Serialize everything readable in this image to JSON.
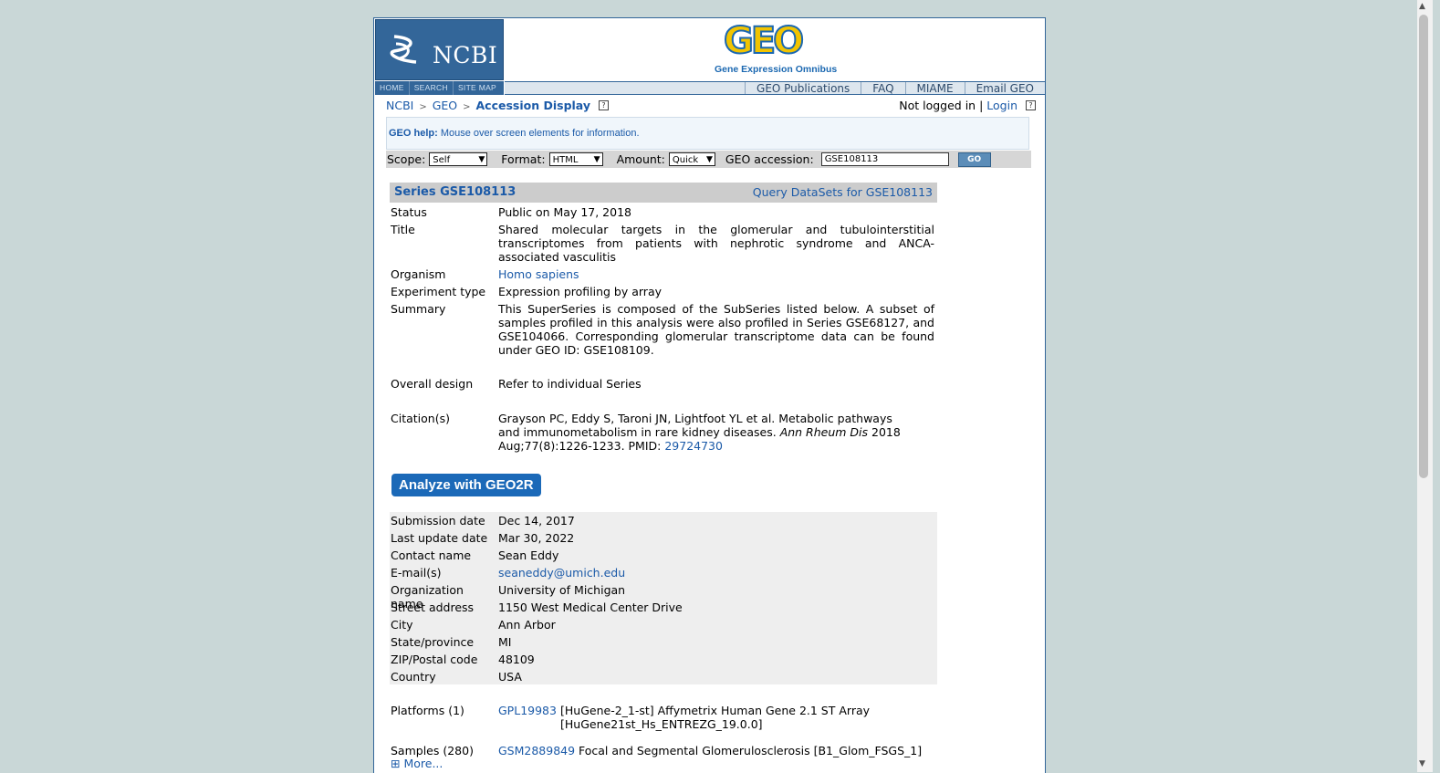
{
  "header": {
    "ncbi_label": "NCBI",
    "geo_logo": "GEO",
    "geo_subtitle": "Gene Expression Omnibus",
    "nav_left": [
      "HOME",
      "SEARCH",
      "SITE MAP"
    ],
    "nav_right": [
      "GEO Publications",
      "FAQ",
      "MIAME",
      "Email GEO"
    ]
  },
  "breadcrumb": {
    "ncbi": "NCBI",
    "geo": "GEO",
    "current": "Accession Display",
    "sep": ">",
    "help": "?"
  },
  "login": {
    "status": "Not logged in",
    "sep": "|",
    "link": "Login",
    "help": "?"
  },
  "help_box": {
    "label": "GEO help:",
    "text": "Mouse over screen elements for information."
  },
  "query": {
    "scope_label": "Scope:",
    "scope_value": "Self",
    "format_label": "Format:",
    "format_value": "HTML",
    "amount_label": "Amount:",
    "amount_value": "Quick",
    "accession_label": "GEO accession:",
    "accession_value": "GSE108113",
    "go_label": "GO"
  },
  "series": {
    "title": "Series GSE108113",
    "query_link": "Query DataSets for GSE108113",
    "fields": {
      "status": {
        "k": "Status",
        "v": "Public on May 17, 2018"
      },
      "title": {
        "k": "Title",
        "v": "Shared molecular targets in the glomerular and tubulointerstitial transcriptomes from patients with nephrotic syndrome and ANCA-associated vasculitis"
      },
      "organism": {
        "k": "Organism",
        "v": "Homo sapiens"
      },
      "exptype": {
        "k": "Experiment type",
        "v": "Expression profiling by array"
      },
      "summary": {
        "k": "Summary",
        "v": "This SuperSeries is composed of the SubSeries listed below. A subset of samples profiled in this analysis were also profiled in Series GSE68127, and GSE104066. Corresponding glomerular transcriptome data can be found under GEO ID: GSE108109."
      },
      "design": {
        "k": "Overall design",
        "v": "Refer to individual Series"
      },
      "citation": {
        "k": "Citation(s)",
        "v1": "Grayson PC, Eddy S, Taroni JN, Lightfoot YL et al. Metabolic pathways and immunometabolism in rare kidney diseases. ",
        "journal": "Ann Rheum Dis",
        "v2": " 2018 Aug;77(8):1226-1233. PMID: ",
        "pmid": "29724730"
      }
    },
    "geo2r_button": "Analyze with GEO2R",
    "contact": {
      "submission": {
        "k": "Submission date",
        "v": "Dec 14, 2017"
      },
      "updated": {
        "k": "Last update date",
        "v": "Mar 30, 2022"
      },
      "name": {
        "k": "Contact name",
        "v": "Sean Eddy"
      },
      "email": {
        "k": "E-mail(s)",
        "v": "seaneddy@umich.edu"
      },
      "org": {
        "k": "Organization name",
        "v": "University of Michigan"
      },
      "street": {
        "k": "Street address",
        "v": "1150 West Medical Center Drive"
      },
      "city": {
        "k": "City",
        "v": "Ann Arbor"
      },
      "state": {
        "k": "State/province",
        "v": "MI"
      },
      "zip": {
        "k": "ZIP/Postal code",
        "v": "48109"
      },
      "country": {
        "k": "Country",
        "v": "USA"
      }
    },
    "platforms": {
      "k": "Platforms (1)",
      "id": "GPL19983",
      "desc": "[HuGene-2_1-st] Affymetrix Human Gene 2.1 ST Array [HuGene21st_Hs_ENTREZG_19.0.0]"
    },
    "samples": {
      "k": "Samples (280)",
      "id": "GSM2889849",
      "desc": "Focal and Segmental Glomerulosclerosis [B1_Glom_FSGS_1]"
    },
    "more": "More..."
  }
}
